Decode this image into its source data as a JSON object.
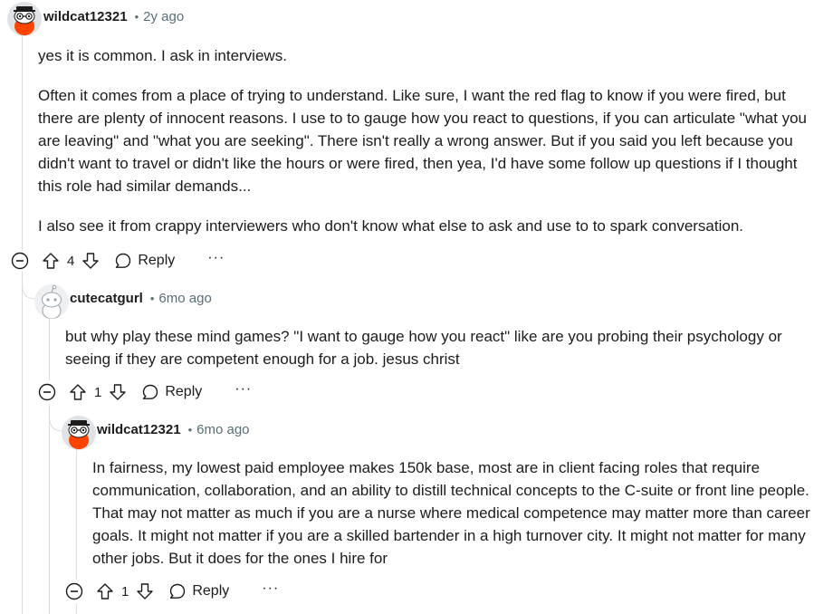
{
  "comments": [
    {
      "username": "wildcat12321",
      "dot": "•",
      "time": "2y ago",
      "paragraphs": [
        "yes it is common. I ask in interviews.",
        "Often it comes from a place of trying to understand. Like sure, I want the red flag to know if you were fired, but there are plenty of innocent reasons. I use to to gauge how you react to questions, if you can articulate \"what you are leaving\" and \"what you are seeking\". There isn't really a wrong answer. But if you said you left because you didn't want to travel or didn't like the hours or were fired, then yea, I'd have some follow up questions if I thought this role had similar demands...",
        "I also see it from crappy interviewers who don't know what else to ask and use to to spark conversation."
      ],
      "score": "4",
      "reply_label": "Reply",
      "more_label": "···"
    },
    {
      "username": "cutecatgurl",
      "dot": "•",
      "time": "6mo ago",
      "paragraphs": [
        "but why play these mind games? \"I want to gauge how you react\" like are you probing their psychology or seeing if they are competent enough for a job. jesus christ"
      ],
      "score": "1",
      "reply_label": "Reply",
      "more_label": "···"
    },
    {
      "username": "wildcat12321",
      "dot": "•",
      "time": "6mo ago",
      "paragraphs": [
        "In fairness, my lowest paid employee makes 150k base, most are in client facing roles that require communication, collaboration, and an ability to distill technical concepts to the C-suite or front line people. That may not matter as much if you are a nurse where medical competence may matter more than career goals. It might not matter if you are a skilled bartender in a high turnover city. It might not matter for many other jobs. But it does for the ones I hire for"
      ],
      "score": "1",
      "reply_label": "Reply",
      "more_label": "···"
    }
  ],
  "colors": {
    "text": "#1c1c1c",
    "meta": "#576f76",
    "thread_line": "#d9dde0",
    "avatar_orange": "#ff4500"
  },
  "icons": {
    "collapse": "minus-circle-icon",
    "upvote": "arrow-up-icon",
    "downvote": "arrow-down-icon",
    "reply": "speech-bubble-icon",
    "more": "ellipsis-icon",
    "avatar": "snoo-avatar-icon"
  }
}
